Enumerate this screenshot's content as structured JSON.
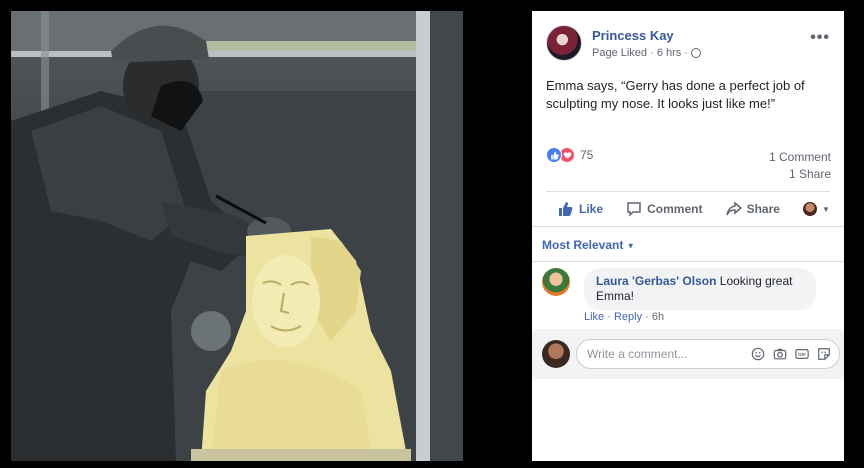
{
  "post": {
    "page_name": "Princess Kay",
    "meta": "Page Liked · 6 hrs ·",
    "text": "Emma says, “Gerry has done a perfect job of sculpting my nose. It looks just like me!”",
    "reaction_count": "75",
    "comment_count": "1 Comment",
    "share_count": "1 Share"
  },
  "actions": {
    "like": "Like",
    "comment": "Comment",
    "share": "Share"
  },
  "comments": {
    "sort_label": "Most Relevant",
    "items": [
      {
        "author": "Laura 'Gerbas' Olson",
        "text": "Looking great Emma!",
        "like": "Like",
        "reply": "Reply",
        "time": "6h"
      }
    ],
    "placeholder": "Write a comment..."
  },
  "colors": {
    "link": "#365899",
    "accent": "#4267b2",
    "like_reaction": "#4a7ef5",
    "love_reaction": "#f2526a",
    "butter": "#ede3a0"
  },
  "icons": [
    "more-options-icon",
    "globe-icon",
    "like-reaction-icon",
    "love-reaction-icon",
    "thumbs-up-icon",
    "comment-icon",
    "share-icon",
    "emoji-icon",
    "camera-icon",
    "gif-icon",
    "sticker-icon"
  ]
}
